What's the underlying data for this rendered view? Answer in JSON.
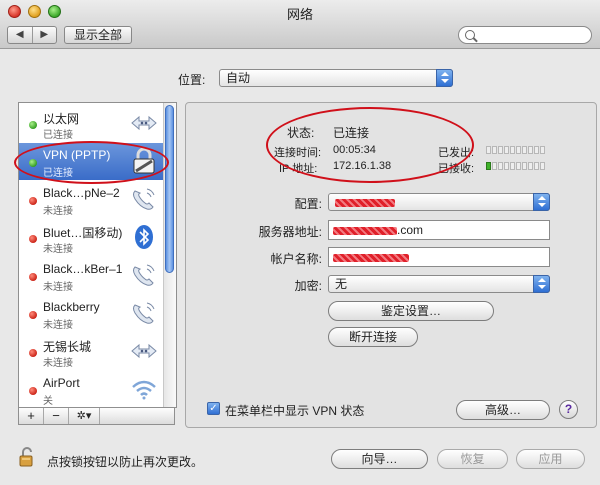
{
  "window": {
    "title": "网络"
  },
  "toolbar": {
    "back": "◀",
    "forward": "▶",
    "show_all": "显示全部",
    "search_placeholder": ""
  },
  "location": {
    "label": "位置:",
    "value": "自动"
  },
  "services": [
    {
      "name": "以太网",
      "status": "已连接",
      "state": "green",
      "icon": "ethernet-arrows-icon"
    },
    {
      "name": "VPN (PPTP)",
      "status": "已连接",
      "state": "green",
      "icon": "vpn-lock-icon",
      "selected": true
    },
    {
      "name": "Black…pNe–2",
      "status": "未连接",
      "state": "red",
      "icon": "phone-modem-icon"
    },
    {
      "name": "Bluet…国移动)",
      "status": "未连接",
      "state": "red",
      "icon": "bluetooth-icon"
    },
    {
      "name": "Black…kBer–1",
      "status": "未连接",
      "state": "red",
      "icon": "phone-modem-icon"
    },
    {
      "name": "Blackberry",
      "status": "未连接",
      "state": "red",
      "icon": "phone-modem-icon"
    },
    {
      "name": "无锡长城",
      "status": "未连接",
      "state": "red",
      "icon": "ethernet-arrows-icon"
    },
    {
      "name": "AirPort",
      "status": "关",
      "state": "red",
      "icon": "wifi-icon"
    }
  ],
  "list_tools": {
    "add": "+",
    "remove": "−",
    "gear": "✲▾"
  },
  "status": {
    "state_label": "状态:",
    "state_value": "已连接",
    "time_label": "连接时间:",
    "time_value": "00:05:34",
    "ip_label": "IP 地址:",
    "ip_value": "172.16.1.38",
    "sent_label": "已发出:",
    "received_label": "已接收:"
  },
  "form": {
    "config_label": "配置:",
    "server_label": "服务器地址:",
    "server_suffix": ".com",
    "account_label": "帐户名称:",
    "encryption_label": "加密:",
    "encryption_value": "无",
    "auth_button": "鉴定设置…",
    "disconnect_button": "断开连接"
  },
  "menubar_checkbox": {
    "label": "在菜单栏中显示 VPN 状态",
    "checked": true
  },
  "advanced_button": "高级…",
  "help_button": "?",
  "lock_text": "点按锁按钮以防止再次更改。",
  "assist_button": "向导…",
  "revert_button": "恢复",
  "apply_button": "应用"
}
